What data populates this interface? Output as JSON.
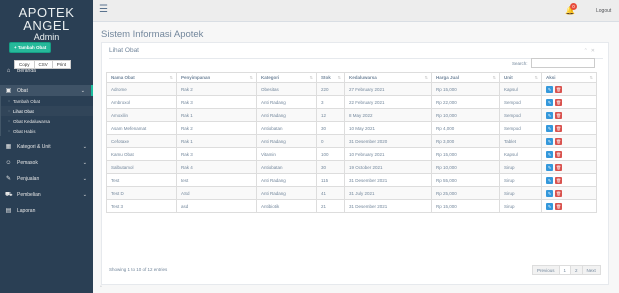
{
  "brand": {
    "line1": "APOTEK",
    "line2": "ANGEL",
    "line3": "Admin"
  },
  "nav": {
    "beranda": "Beranda",
    "obat": "Obat",
    "sub": [
      "Tambah Obat",
      "Lihat Obat",
      "Obat Kedaluwarsa",
      "Obat Habis"
    ],
    "kategori": "Kategori & Unit",
    "pemasok": "Pemasok",
    "penjualan": "Penjualan",
    "pembelian": "Pembelian",
    "laporan": "Laporan"
  },
  "topbar": {
    "menu_icon": "☰",
    "bell_icon": "🔔",
    "bell_count": "0",
    "logout": "Logout"
  },
  "page_title": "Sistem Informasi Apotek",
  "panel": {
    "title": "Lihat Obat",
    "tools": "⌃ ✕"
  },
  "add_button": "+ Tambah Obat",
  "export_buttons": [
    "Copy",
    "CSV",
    "Print"
  ],
  "search_label": "Search:",
  "search_value": "",
  "columns": [
    "Nama Obat",
    "Penyimpanan",
    "Kategori",
    "Stok",
    "Kedaluwarsa",
    "Harga Jual",
    "Unit",
    "Aksi"
  ],
  "rows": [
    [
      "Adrome",
      "Rak 2",
      "Obesitas",
      "220",
      "27 February 2021",
      "Rp 15,000",
      "Kapsul"
    ],
    [
      "Ambroxol",
      "Rak 3",
      "Anti Radang",
      "3",
      "22 February 2021",
      "Rp 22,000",
      "Sempod"
    ],
    [
      "Amoxilin",
      "Rak 1",
      "Anti Radang",
      "12",
      "8 May 2022",
      "Rp 10,000",
      "Sempod"
    ],
    [
      "Asam Mefenamat",
      "Rak 2",
      "Antiobatan",
      "30",
      "10 May 2021",
      "Rp 4,000",
      "Sempod"
    ],
    [
      "Cefotaxe",
      "Rak 1",
      "Anti Radang",
      "0",
      "31 Desember 2020",
      "Rp 3,000",
      "Tablet"
    ],
    [
      "Kamu Obat",
      "Rak 3",
      "Vitamin",
      "100",
      "10 February 2021",
      "Rp 15,000",
      "Kapsul"
    ],
    [
      "Salbutamol",
      "Rak 4",
      "Antiobatan",
      "30",
      "19 October 2021",
      "Rp 10,000",
      "Sirup"
    ],
    [
      "Test",
      "test",
      "Anti Radang",
      "115",
      "31 Desember 2021",
      "Rp 55,000",
      "Sirup"
    ],
    [
      "Test D",
      "ASd",
      "Anti Radang",
      "41",
      "31 July 2021",
      "Rp 25,000",
      "Sirup"
    ],
    [
      "Test 3",
      "asd",
      "Antibiotik",
      "21",
      "31 Desember 2021",
      "Rp 15,000",
      "Sirup"
    ]
  ],
  "actions": {
    "edit_icon": "✎",
    "delete_icon": "🗑"
  },
  "showing": "Showing 1 to 10 of 12 entries",
  "pager": {
    "previous": "Previous",
    "page1": "1",
    "page2": "2",
    "next": "Next"
  },
  "colors": {
    "sidebar": "#2A3F54",
    "accent": "#1ABB9C",
    "add": "#26B99A",
    "edit": "#3498DB",
    "delete": "#D9534F",
    "badge": "#E74C3C"
  }
}
